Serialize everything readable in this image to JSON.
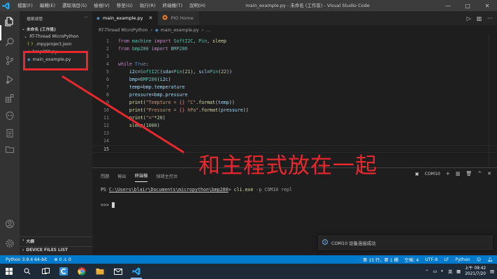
{
  "window": {
    "title": "main_example.py - 未命名 (工作區) - Visual Studio Code",
    "menu": [
      "檔案(F)",
      "編輯(E)",
      "選取項目(S)",
      "檢視(V)",
      "移至(G)",
      "執行(R)",
      "終端機(T)",
      "說明(H)"
    ],
    "minimize": "—",
    "maximize": "□",
    "close": "✕"
  },
  "sidebar": {
    "header": "檔案總管",
    "more": "···",
    "workspace": "未命名 (工作區)",
    "folder": "RT-Thread MicroPython",
    "files": [
      {
        "icon": "{ }",
        "name": ".mpyproject.json"
      },
      {
        "icon": "◆",
        "name": "bmp280.py"
      },
      {
        "icon": "◆",
        "name": "main_example.py"
      }
    ],
    "outline_section": "大綱",
    "device_section": "DEVICE FILES LIST"
  },
  "tabs": [
    {
      "label": "main_example.py",
      "active": true,
      "close": "✕"
    },
    {
      "label": "PIO Home",
      "active": false
    }
  ],
  "breadcrumb": [
    "RT-Thread MicroPython",
    "main_example.py",
    "..."
  ],
  "editor": {
    "current_line": 15,
    "lines": [
      {
        "n": "1",
        "tokens": [
          {
            "t": "from ",
            "c": "kw"
          },
          {
            "t": "machine ",
            "c": "cls"
          },
          {
            "t": "import ",
            "c": "kw"
          },
          {
            "t": "SoftI2C",
            "c": "cls"
          },
          {
            "t": ", ",
            "c": "pl"
          },
          {
            "t": "Pin",
            "c": "cls"
          },
          {
            "t": ", ",
            "c": "pl"
          },
          {
            "t": "sleep",
            "c": "fn"
          }
        ]
      },
      {
        "n": "2",
        "tokens": [
          {
            "t": "from ",
            "c": "kw"
          },
          {
            "t": "bmp280 ",
            "c": "cls"
          },
          {
            "t": "import ",
            "c": "kw"
          },
          {
            "t": "BMP280",
            "c": "cls"
          }
        ]
      },
      {
        "n": "3",
        "tokens": []
      },
      {
        "n": "4",
        "tokens": [
          {
            "t": "while ",
            "c": "kw"
          },
          {
            "t": "True",
            "c": "kw2"
          },
          {
            "t": ":",
            "c": "pl"
          }
        ]
      },
      {
        "n": "5",
        "tokens": [
          {
            "t": "    i2c",
            "c": "var"
          },
          {
            "t": "=",
            "c": "pl"
          },
          {
            "t": "SoftI2C",
            "c": "cls"
          },
          {
            "t": "(",
            "c": "pl"
          },
          {
            "t": "sda",
            "c": "var"
          },
          {
            "t": "=",
            "c": "pl"
          },
          {
            "t": "Pin",
            "c": "cls"
          },
          {
            "t": "(",
            "c": "pl"
          },
          {
            "t": "21",
            "c": "num"
          },
          {
            "t": "), ",
            "c": "pl"
          },
          {
            "t": "scl",
            "c": "var"
          },
          {
            "t": "=",
            "c": "pl"
          },
          {
            "t": "Pin",
            "c": "cls"
          },
          {
            "t": "(",
            "c": "pl"
          },
          {
            "t": "22",
            "c": "num"
          },
          {
            "t": "))",
            "c": "pl"
          }
        ]
      },
      {
        "n": "6",
        "tokens": [
          {
            "t": "    bmp",
            "c": "var"
          },
          {
            "t": "=",
            "c": "pl"
          },
          {
            "t": "BMP280",
            "c": "cls"
          },
          {
            "t": "(",
            "c": "pl"
          },
          {
            "t": "i2c",
            "c": "var"
          },
          {
            "t": ")",
            "c": "pl"
          }
        ]
      },
      {
        "n": "7",
        "tokens": [
          {
            "t": "    temp",
            "c": "var"
          },
          {
            "t": "=",
            "c": "pl"
          },
          {
            "t": "bmp",
            "c": "var"
          },
          {
            "t": ".",
            "c": "pl"
          },
          {
            "t": "temperature",
            "c": "var"
          }
        ]
      },
      {
        "n": "8",
        "tokens": [
          {
            "t": "    pressure",
            "c": "var"
          },
          {
            "t": "=",
            "c": "pl"
          },
          {
            "t": "bmp",
            "c": "var"
          },
          {
            "t": ".",
            "c": "pl"
          },
          {
            "t": "pressure",
            "c": "var"
          }
        ]
      },
      {
        "n": "9",
        "tokens": [
          {
            "t": "    print",
            "c": "fn"
          },
          {
            "t": "(",
            "c": "pl"
          },
          {
            "t": "\"Tempture = {} °C\"",
            "c": "str"
          },
          {
            "t": ".",
            "c": "pl"
          },
          {
            "t": "format",
            "c": "fn"
          },
          {
            "t": "(",
            "c": "pl"
          },
          {
            "t": "temp",
            "c": "var"
          },
          {
            "t": "))",
            "c": "pl"
          }
        ]
      },
      {
        "n": "10",
        "tokens": [
          {
            "t": "    print",
            "c": "fn"
          },
          {
            "t": "(",
            "c": "pl"
          },
          {
            "t": "\"Pressure = {} hPa\"",
            "c": "str"
          },
          {
            "t": ".",
            "c": "pl"
          },
          {
            "t": "format",
            "c": "fn"
          },
          {
            "t": "(",
            "c": "pl"
          },
          {
            "t": "pressure",
            "c": "var"
          },
          {
            "t": "))",
            "c": "pl"
          }
        ]
      },
      {
        "n": "11",
        "tokens": [
          {
            "t": "    print",
            "c": "fn"
          },
          {
            "t": "(",
            "c": "pl"
          },
          {
            "t": "\"=\"",
            "c": "str"
          },
          {
            "t": "*",
            "c": "pl"
          },
          {
            "t": "20",
            "c": "num"
          },
          {
            "t": ")",
            "c": "pl"
          }
        ]
      },
      {
        "n": "12",
        "tokens": [
          {
            "t": "    sleep",
            "c": "fn"
          },
          {
            "t": "(",
            "c": "pl"
          },
          {
            "t": "1000",
            "c": "num"
          },
          {
            "t": ")",
            "c": "pl"
          }
        ]
      },
      {
        "n": "13",
        "tokens": []
      },
      {
        "n": "14",
        "tokens": []
      },
      {
        "n": "15",
        "tokens": []
      }
    ]
  },
  "panel": {
    "tabs": [
      {
        "label": "問題",
        "active": false
      },
      {
        "label": "輸出",
        "active": false
      },
      {
        "label": "終端機",
        "active": true
      },
      {
        "label": "偵錯主控台",
        "active": false
      }
    ],
    "terminal_select": "COM10",
    "add": "+",
    "maximize": "^",
    "close": "✕",
    "terminal": {
      "prompt": "PS ",
      "path": "C:\\Users\\blair\\Documents\\micropython\\bmp280",
      "prompt_end": "> ",
      "cmd": "cli.exe",
      "args": " -p COM10 repl",
      "repl": ">>> "
    }
  },
  "notification": {
    "message": "COM10 设备连接成功",
    "settings": "⚙",
    "close": "✕"
  },
  "statusbar": {
    "python": "Python 3.9.4 64-bit",
    "problems": "⊗ 0 ⚠ 0",
    "position": "第 15 行，第 1 欄",
    "spaces": "空格: 4",
    "encoding": "UTF-8",
    "eol": "LF",
    "language": "Python"
  },
  "taskbar": {
    "ime": "英",
    "time": "上午 09:42",
    "date": "2021/7/20"
  },
  "annotation": {
    "text": "和主程式放在一起"
  },
  "colors": {
    "accent": "#007acc",
    "annotation": "#e8282d"
  }
}
